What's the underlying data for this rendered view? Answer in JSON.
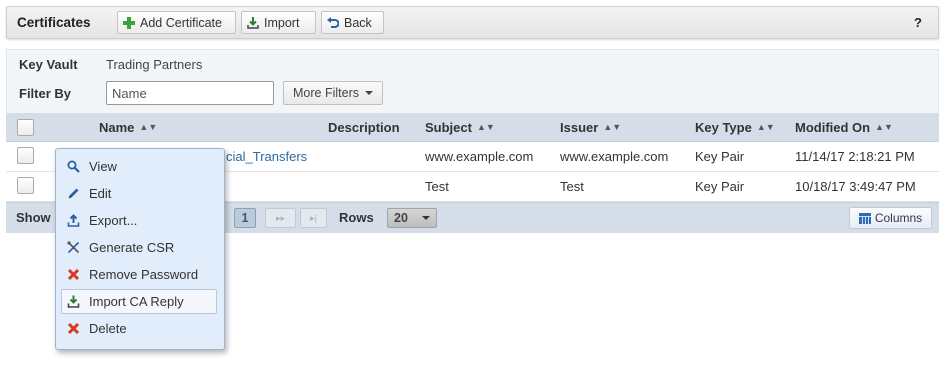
{
  "toolbar": {
    "title": "Certificates",
    "add_label": "Add Certificate",
    "import_label": "Import",
    "back_label": "Back",
    "help_label": "?"
  },
  "filters": {
    "key_vault_label": "Key Vault",
    "key_vault_value": "Trading Partners",
    "filter_by_label": "Filter By",
    "name_placeholder": "Name",
    "more_filters_label": "More Filters"
  },
  "table": {
    "columns": [
      "Name",
      "Description",
      "Subject",
      "Issuer",
      "Key Type",
      "Modified On"
    ],
    "rows": [
      {
        "name": "cial_Transfers",
        "description": "",
        "subject": "www.example.com",
        "issuer": "www.example.com",
        "key_type": "Key Pair",
        "modified_on": "11/14/17 2:18:21 PM"
      },
      {
        "name": "",
        "description": "",
        "subject": "Test",
        "issuer": "Test",
        "key_type": "Key Pair",
        "modified_on": "10/18/17 3:49:47 PM"
      }
    ]
  },
  "pager": {
    "show_label": "Show",
    "current_page": "1",
    "rows_label": "Rows",
    "rows_value": "20",
    "columns_label": "Columns"
  },
  "context_menu": {
    "items": [
      {
        "label": "View",
        "icon": "magnifier-icon"
      },
      {
        "label": "Edit",
        "icon": "pencil-icon"
      },
      {
        "label": "Export...",
        "icon": "export-icon"
      },
      {
        "label": "Generate CSR",
        "icon": "tools-icon"
      },
      {
        "label": "Remove Password",
        "icon": "red-x-icon"
      },
      {
        "label": "Import CA Reply",
        "icon": "import-icon"
      },
      {
        "label": "Delete",
        "icon": "red-x-icon"
      }
    ],
    "highlighted": "Import CA Reply"
  },
  "colors": {
    "header_bg": "#d5dee8",
    "menu_bg": "#e1edfa",
    "link": "#2c6aa0",
    "add_green": "#3aa33a",
    "delete_red": "#d9391f"
  }
}
